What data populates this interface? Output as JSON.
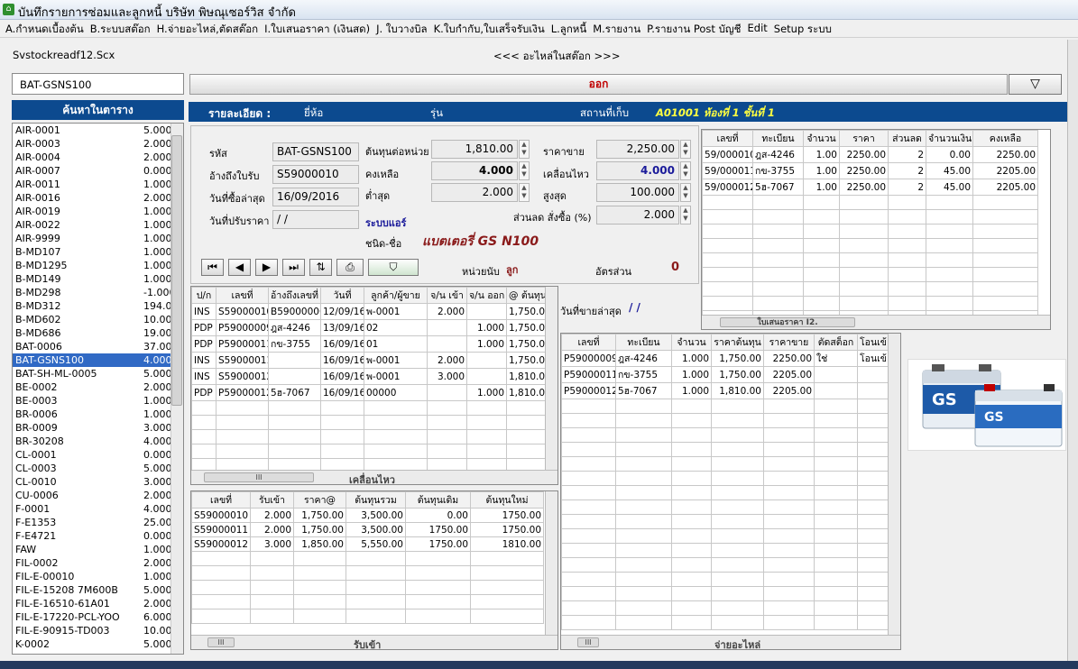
{
  "window": {
    "title": "บันทึกรายการซ่อมและลูกหนี้ บริษัท พิษณุเซอร์วิส  จำกัด"
  },
  "menu": [
    "A.กำหนดเบื้องต้น",
    "B.ระบบสต๊อก",
    "H.จ่ายอะไหล่,ตัดสต๊อก",
    "I.ใบเสนอราคา (เงินสด)",
    "J. ใบวางบิล",
    "K.ใบกำกับ,ใบเสร็จรับเงิน",
    "L.ลูกหนี้",
    "M.รายงาน",
    "P.รายงาน Post บัญชี",
    "Edit",
    "Setup ระบบ"
  ],
  "form": {
    "name": "Svstockreadf12.Scx",
    "caption": "<<< อะไหล่ในสต๊อก >>>"
  },
  "search": {
    "value": "BAT-GSNS100"
  },
  "exit_label": "ออก",
  "filter_icon": "filter-icon",
  "list": {
    "header": "ค้นหาในตาราง",
    "items": [
      {
        "code": "AIR-0001",
        "qty": "5.000"
      },
      {
        "code": "AIR-0003",
        "qty": "2.000"
      },
      {
        "code": "AIR-0004",
        "qty": "2.000"
      },
      {
        "code": "AIR-0007",
        "qty": "0.000"
      },
      {
        "code": "AIR-0011",
        "qty": "1.000"
      },
      {
        "code": "AIR-0016",
        "qty": "2.000"
      },
      {
        "code": "AIR-0019",
        "qty": "1.000"
      },
      {
        "code": "AIR-0022",
        "qty": "1.000"
      },
      {
        "code": "AIR-9999",
        "qty": "1.000"
      },
      {
        "code": "B-MD107",
        "qty": "1.000"
      },
      {
        "code": "B-MD1295",
        "qty": "1.000"
      },
      {
        "code": "B-MD149",
        "qty": "1.000"
      },
      {
        "code": "B-MD298",
        "qty": "-1.000"
      },
      {
        "code": "B-MD312",
        "qty": "194.00"
      },
      {
        "code": "B-MD602",
        "qty": "10.00"
      },
      {
        "code": "B-MD686",
        "qty": "19.00"
      },
      {
        "code": "BAT-0006",
        "qty": "37.00"
      },
      {
        "code": "BAT-GSNS100",
        "qty": "4.000",
        "selected": true
      },
      {
        "code": "BAT-SH-ML-0005",
        "qty": "5.000"
      },
      {
        "code": "BE-0002",
        "qty": "2.000"
      },
      {
        "code": "BE-0003",
        "qty": "1.000"
      },
      {
        "code": "BR-0006",
        "qty": "1.000"
      },
      {
        "code": "BR-0009",
        "qty": "3.000"
      },
      {
        "code": "BR-30208",
        "qty": "4.000"
      },
      {
        "code": "CL-0001",
        "qty": "0.000"
      },
      {
        "code": "CL-0003",
        "qty": "5.000"
      },
      {
        "code": "CL-0010",
        "qty": "3.000"
      },
      {
        "code": "CU-0006",
        "qty": "2.000"
      },
      {
        "code": "F-0001",
        "qty": "4.000"
      },
      {
        "code": "F-E1353",
        "qty": "25.00"
      },
      {
        "code": "F-E4721",
        "qty": "0.000"
      },
      {
        "code": "FAW",
        "qty": "1.000"
      },
      {
        "code": "FIL-0002",
        "qty": "2.000"
      },
      {
        "code": "FIL-E-00010",
        "qty": "1.000"
      },
      {
        "code": "FIL-E-15208 7M600B",
        "qty": "5.000"
      },
      {
        "code": "FIL-E-16510-61A01",
        "qty": "2.000"
      },
      {
        "code": "FIL-E-17220-PCL-YOO",
        "qty": "6.000"
      },
      {
        "code": "FIL-E-90915-TD003",
        "qty": "10.00"
      },
      {
        "code": "K-0002",
        "qty": "5.000"
      }
    ]
  },
  "detail_header": {
    "title": "รายละเอียด :",
    "brand_label": "ยี่ห้อ",
    "model_label": "รุ่น",
    "location_label": "สถานที่เก็บ",
    "location_value": "A01001  ห้องที่ 1 ชั้นที่ 1"
  },
  "info": {
    "code_label": "รหัส",
    "code": "BAT-GSNS100",
    "ref_label": "อ้างถึงใบรับ",
    "ref": "S59000010",
    "lastbuy_label": "วันที่ซื้อล่าสุด",
    "lastbuy": "16/09/2016",
    "priceadj_label": "วันที่ปรับราคา",
    "priceadj": "/ /",
    "unitcost_label": "ต้นทุนต่อหน่วย",
    "unitcost": "1,810.00",
    "remain_label": "คงเหลือ",
    "remain": "4.000",
    "min_label": "ต่ำสุด",
    "min": "2.000",
    "price_label": "ราคาขาย",
    "price": "2,250.00",
    "movement_label": "เคลื่อนไหว",
    "movement": "4.000",
    "max_label": "สูงสุด",
    "max": "100.000",
    "discount_label": "ส่วนลด สั่งซื้อ (%)",
    "discount": "2.000",
    "system_label": "ระบบแอร์",
    "type_label": "ชนิด-ชื่อ",
    "type_value": "แบตเตอรี่ GS N100",
    "unit_label": "หน่วยนับ",
    "unit_value": "ลูก",
    "ratio_label": "อัตรส่วน",
    "ratio_value": "0",
    "last_sale_label": "วันที่ขายล่าสุด",
    "last_sale_value": "/ /"
  },
  "quote_grid": {
    "columns": [
      "เลขที่",
      "ทะเบียน",
      "จำนวน",
      "ราคา",
      "ส่วนลด",
      "จำนวนเงิน",
      "คงเหลือ"
    ],
    "rows": [
      [
        "59/000010",
        "ฎส-4246",
        "1.00",
        "2250.00",
        "2",
        "0.00",
        "2250.00"
      ],
      [
        "59/000011",
        "กข-3755",
        "1.00",
        "2250.00",
        "2",
        "45.00",
        "2205.00"
      ],
      [
        "59/000012",
        "5ฮ-7067",
        "1.00",
        "2250.00",
        "2",
        "45.00",
        "2205.00"
      ]
    ],
    "scroll_label": "ใบเสนอราคา I2."
  },
  "movement_grid": {
    "columns": [
      "ป/ก",
      "เลขที่",
      "อ้างถึงเลขที่",
      "วันที่",
      "ลูกค้า/ผู้ขาย",
      "จ/น เข้า",
      "จ/น ออก",
      "@ ต้นทุน"
    ],
    "rows": [
      [
        "INS",
        "S59000010",
        "B59000006",
        "12/09/16",
        "พ-0001",
        "2.000",
        "",
        "1,750.00"
      ],
      [
        "PDP",
        "P59000009",
        "ฎส-4246",
        "13/09/16",
        "02",
        "",
        "1.000",
        "1,750.00"
      ],
      [
        "PDP",
        "P59000011",
        "กข-3755",
        "16/09/16",
        "01",
        "",
        "1.000",
        "1,750.00"
      ],
      [
        "INS",
        "S59000011",
        "",
        "16/09/16",
        "พ-0001",
        "2.000",
        "",
        "1,750.00"
      ],
      [
        "INS",
        "S59000012",
        "",
        "16/09/16",
        "พ-0001",
        "3.000",
        "",
        "1,810.00"
      ],
      [
        "PDP",
        "P59000012",
        "5ฮ-7067",
        "16/09/16",
        "00000",
        "",
        "1.000",
        "1,810.00"
      ]
    ],
    "scroll_label": "เคลื่อนไหว"
  },
  "receive_grid": {
    "columns": [
      "เลขที่",
      "รับเข้า",
      "ราคา@",
      "ต้นทุนรวม",
      "ต้นทุนเดิม",
      "ต้นทุนใหม่"
    ],
    "rows": [
      [
        "S59000010",
        "2.000",
        "1,750.00",
        "3,500.00",
        "0.00",
        "1750.00"
      ],
      [
        "S59000011",
        "2.000",
        "1,750.00",
        "3,500.00",
        "1750.00",
        "1750.00"
      ],
      [
        "S59000012",
        "3.000",
        "1,850.00",
        "5,550.00",
        "1750.00",
        "1810.00"
      ]
    ],
    "scroll_label": "รับเข้า"
  },
  "issue_grid": {
    "columns": [
      "เลขที่",
      "ทะเบียน",
      "จำนวน",
      "ราคาต้นทุน",
      "ราคาขาย",
      "ตัดสต็อก",
      "โอนเข้"
    ],
    "rows": [
      [
        "P59000009",
        "ฎส-4246",
        "1.000",
        "1,750.00",
        "2250.00",
        "ใช่",
        "โอนเข้"
      ],
      [
        "P59000011",
        "กข-3755",
        "1.000",
        "1,750.00",
        "2205.00",
        "",
        ""
      ],
      [
        "P59000012",
        "5ฮ-7067",
        "1.000",
        "1,810.00",
        "2205.00",
        "",
        ""
      ]
    ],
    "scroll_label": "จ่ายอะไหล่"
  },
  "product_image": {
    "brand_text": "GS"
  }
}
